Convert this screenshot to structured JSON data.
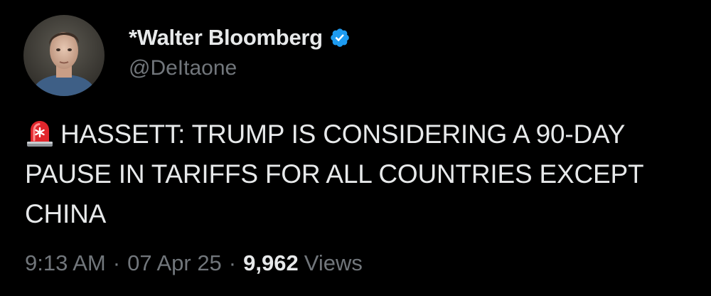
{
  "author": {
    "display_name": "*Walter Bloomberg",
    "handle": "@DeItaone",
    "verified": true,
    "avatar_icon": "profile-photo",
    "badge_icon": "verified-badge-icon",
    "badge_color": "#1d9bf0"
  },
  "tweet": {
    "emoji_icon": "police-siren-icon",
    "text": "HASSETT: TRUMP IS CONSIDERING A 90-DAY PAUSE IN TARIFFS FOR ALL COUNTRIES EXCEPT CHINA"
  },
  "meta": {
    "time": "9:13 AM",
    "separator": "·",
    "date": "07 Apr 25",
    "views_count": "9,962",
    "views_label": "Views"
  },
  "theme": {
    "background": "#000000",
    "primary_text": "#e7e9ea",
    "secondary_text": "#71767b"
  }
}
